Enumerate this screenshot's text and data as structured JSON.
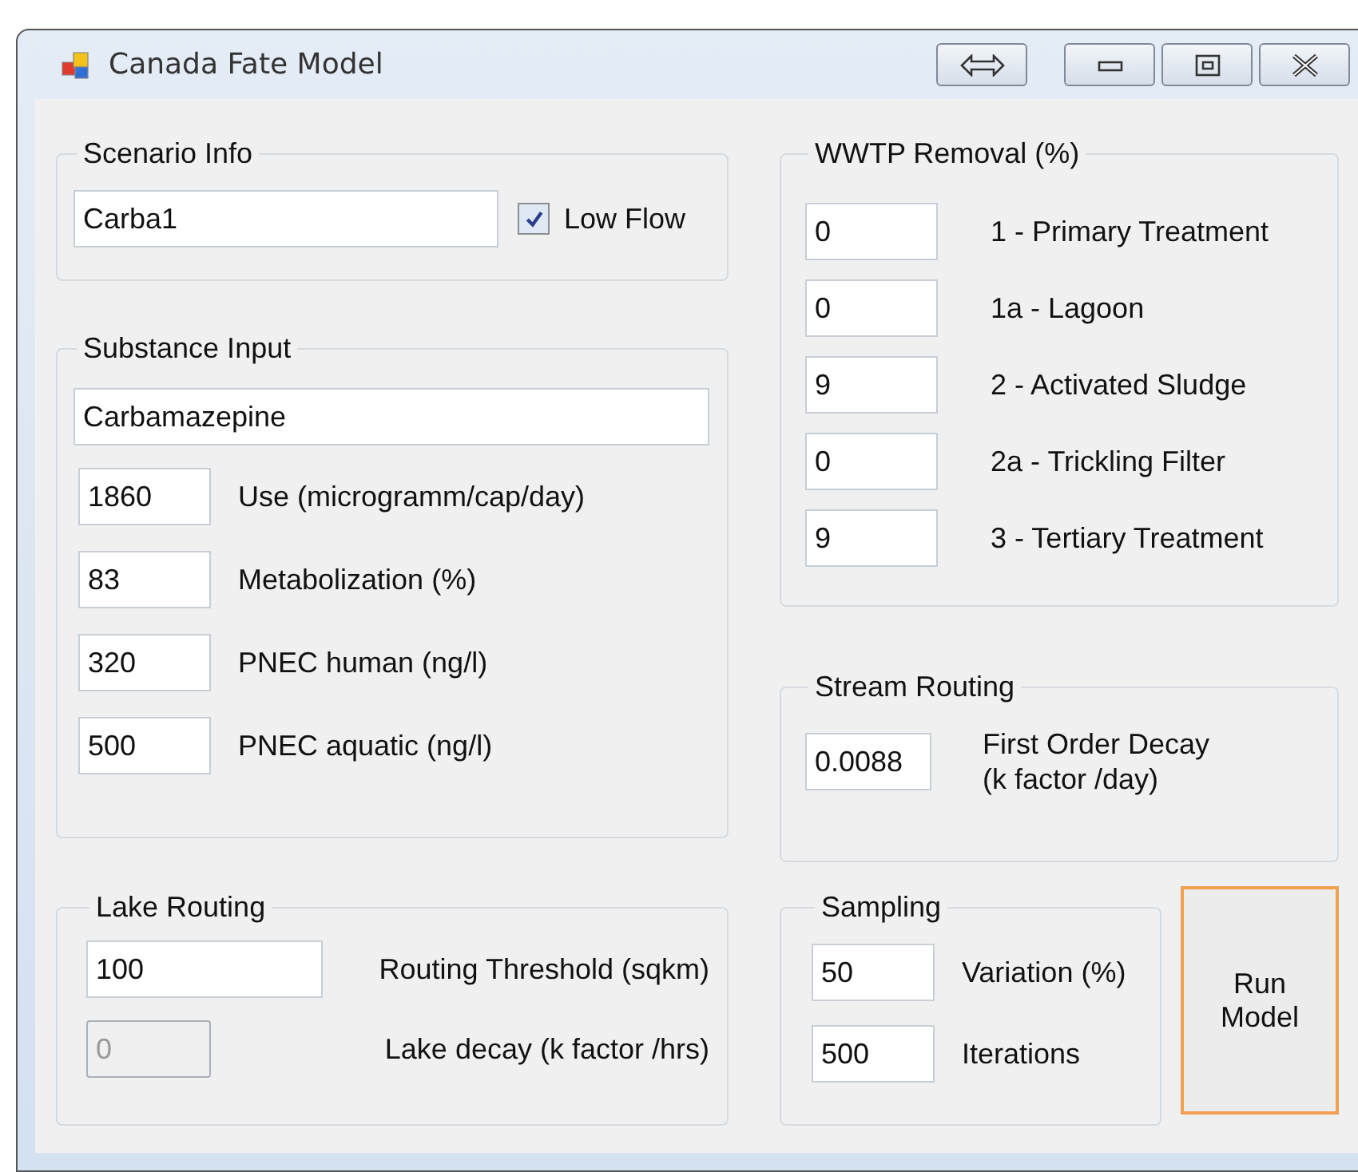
{
  "window": {
    "title": "Canada Fate Model"
  },
  "scenario_info": {
    "title": "Scenario Info",
    "name": {
      "value": "Carba1"
    },
    "low_flow": {
      "label": "Low Flow",
      "checked": true
    }
  },
  "substance_input": {
    "title": "Substance Input",
    "substance": {
      "value": "Carbamazepine"
    },
    "fields": [
      {
        "value": "1860",
        "label": "Use (microgramm/cap/day)"
      },
      {
        "value": "83",
        "label": "Metabolization (%)"
      },
      {
        "value": "320",
        "label": "PNEC human (ng/l)"
      },
      {
        "value": "500",
        "label": "PNEC aquatic (ng/l)"
      }
    ]
  },
  "lake_routing": {
    "title": "Lake Routing",
    "fields": [
      {
        "value": "100",
        "label": "Routing Threshold (sqkm)",
        "disabled": false
      },
      {
        "value": "0",
        "label": "Lake decay (k factor /hrs)",
        "disabled": true
      }
    ]
  },
  "wwtp_removal": {
    "title": "WWTP Removal (%)",
    "fields": [
      {
        "value": "0",
        "label": "1 - Primary Treatment"
      },
      {
        "value": "0",
        "label": "1a - Lagoon"
      },
      {
        "value": "9",
        "label": "2 - Activated Sludge"
      },
      {
        "value": "0",
        "label": "2a - Trickling Filter"
      },
      {
        "value": "9",
        "label": "3 - Tertiary Treatment"
      }
    ]
  },
  "stream_routing": {
    "title": "Stream Routing",
    "field": {
      "value": "0.0088",
      "label": "First Order Decay (k factor /day)"
    }
  },
  "sampling": {
    "title": "Sampling",
    "fields": [
      {
        "value": "50",
        "label": "Variation (%)"
      },
      {
        "value": "500",
        "label": "Iterations"
      }
    ]
  },
  "run_button": {
    "label": "Run Model",
    "focused": true
  }
}
